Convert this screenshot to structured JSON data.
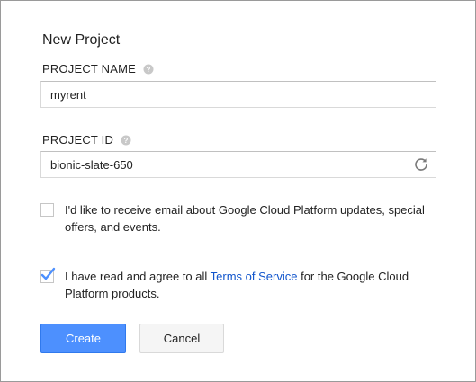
{
  "dialog": {
    "title": "New Project"
  },
  "project_name": {
    "label": "PROJECT NAME",
    "value": "myrent",
    "help_icon": "help-circle-icon"
  },
  "project_id": {
    "label": "PROJECT ID",
    "value": "bionic-slate-650",
    "help_icon": "help-circle-icon",
    "refresh_icon": "refresh-icon"
  },
  "email_opt_in": {
    "checked": false,
    "text": "I'd like to receive email about Google Cloud Platform updates, special offers, and events."
  },
  "terms": {
    "checked": true,
    "text_before": "I have read and agree to all ",
    "link_text": "Terms of Service",
    "text_after": " for the Google Cloud Platform products."
  },
  "buttons": {
    "create": "Create",
    "cancel": "Cancel"
  },
  "colors": {
    "primary_button": "#4d90fe",
    "link": "#1155cc",
    "checkmark": "#4d90fe"
  }
}
